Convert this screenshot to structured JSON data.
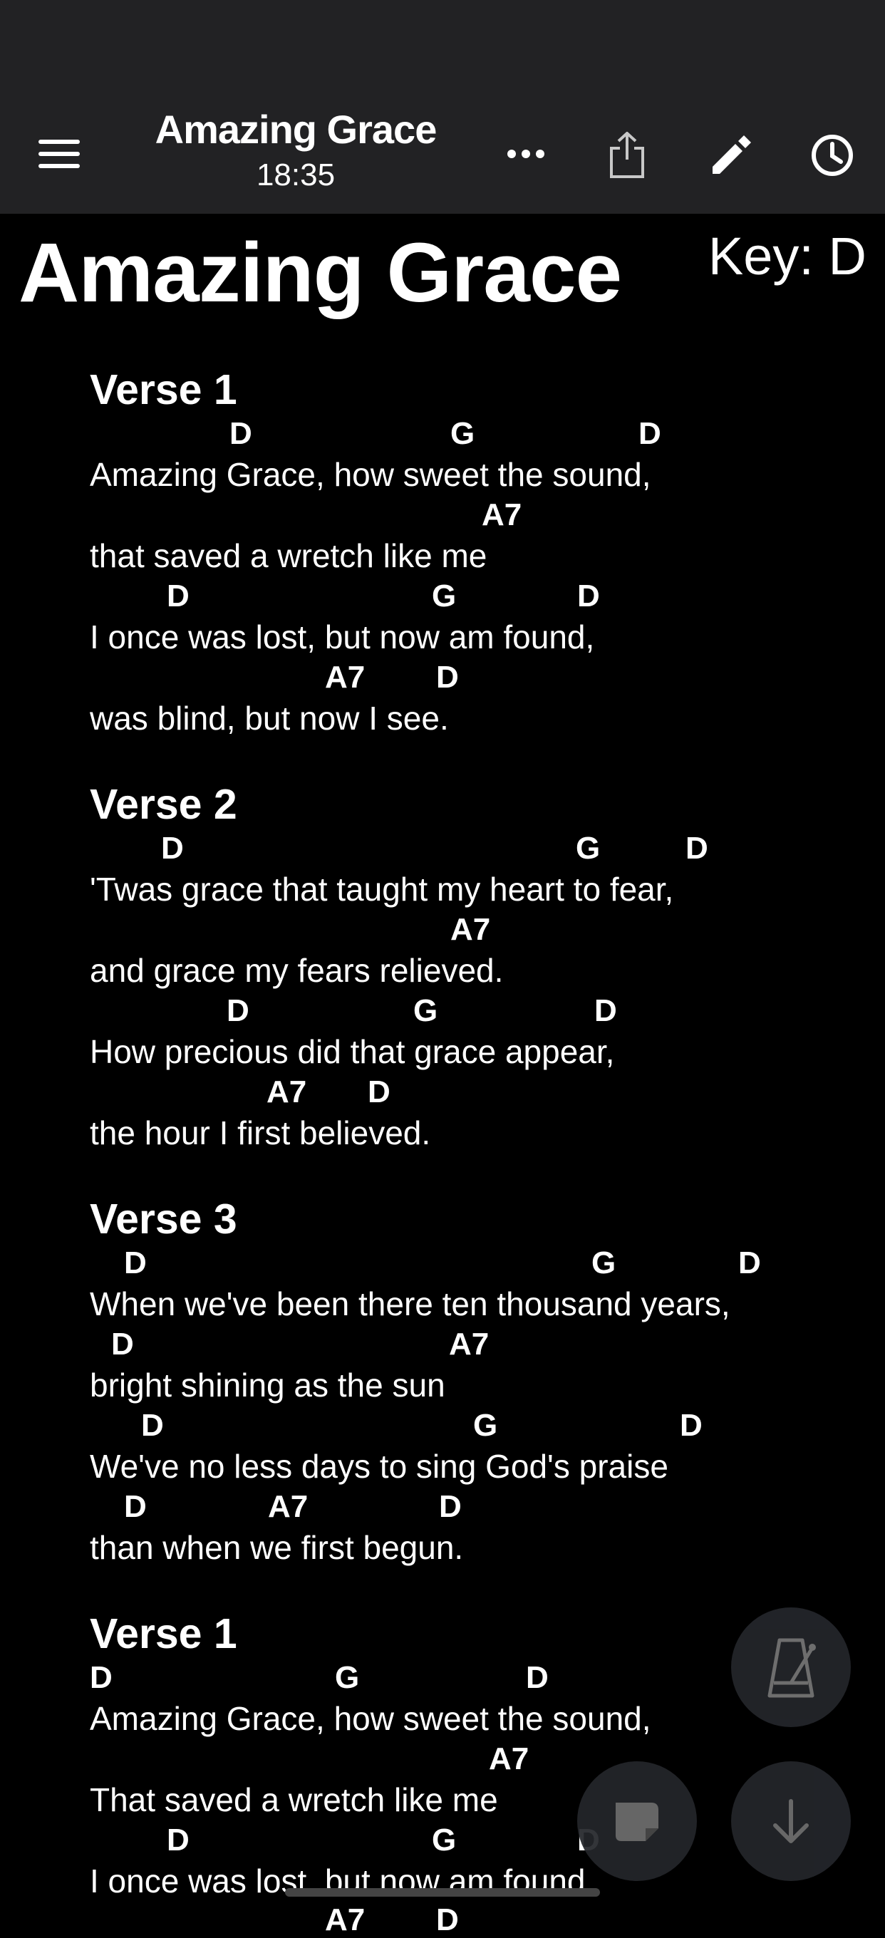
{
  "header": {
    "title": "Amazing Grace",
    "time": "18:35",
    "icons": [
      "menu-icon",
      "more-icon",
      "share-icon",
      "edit-icon",
      "history-icon"
    ]
  },
  "song": {
    "title": "Amazing Grace",
    "key_label": "Key: D"
  },
  "sections": [
    {
      "name": "Verse 1",
      "lines": [
        {
          "chords": [
            "D",
            "G",
            "D"
          ],
          "lyric": "Amazing Grace, how sweet the sound,"
        },
        {
          "chords": [
            "A7"
          ],
          "lyric": "that saved a wretch like me"
        },
        {
          "chords": [
            "D",
            "G",
            "D"
          ],
          "lyric": "I once was lost, but now am found,"
        },
        {
          "chords": [
            "A7",
            "D"
          ],
          "lyric": "was blind, but now I see."
        }
      ]
    },
    {
      "name": "Verse 2",
      "lines": [
        {
          "chords": [
            "D",
            "G",
            "D"
          ],
          "lyric": "'Twas grace that taught my heart to fear,"
        },
        {
          "chords": [
            "A7"
          ],
          "lyric": "and grace my fears relieved."
        },
        {
          "chords": [
            "D",
            "G",
            "D"
          ],
          "lyric": "How precious did that grace appear,"
        },
        {
          "chords": [
            "A7",
            "D"
          ],
          "lyric": "the hour I first believed."
        }
      ]
    },
    {
      "name": "Verse 3",
      "lines": [
        {
          "chords": [
            "D",
            "G",
            "D"
          ],
          "lyric": "When we've been there ten thousand years,"
        },
        {
          "chords": [
            "D",
            "A7"
          ],
          "lyric": "bright shining as the sun"
        },
        {
          "chords": [
            "D",
            "G",
            "D"
          ],
          "lyric": "We've no less days to sing God's praise"
        },
        {
          "chords": [
            "D",
            "A7",
            "D"
          ],
          "lyric": "than when we first begun."
        }
      ]
    },
    {
      "name": "Verse 1",
      "lines": [
        {
          "chords": [
            "D",
            "G",
            "D"
          ],
          "lyric": "Amazing Grace, how sweet the sound,"
        },
        {
          "chords": [
            "A7"
          ],
          "lyric": "That saved a wretch like me"
        },
        {
          "chords": [
            "D",
            "G",
            "D"
          ],
          "lyric": "I once was lost, but now am found,"
        },
        {
          "chords": [
            "A7",
            "D"
          ],
          "lyric": ""
        }
      ]
    }
  ],
  "fabs": {
    "metronome": "metronome-icon",
    "pdf": "document-icon",
    "scroll_down": "arrow-down-icon"
  }
}
